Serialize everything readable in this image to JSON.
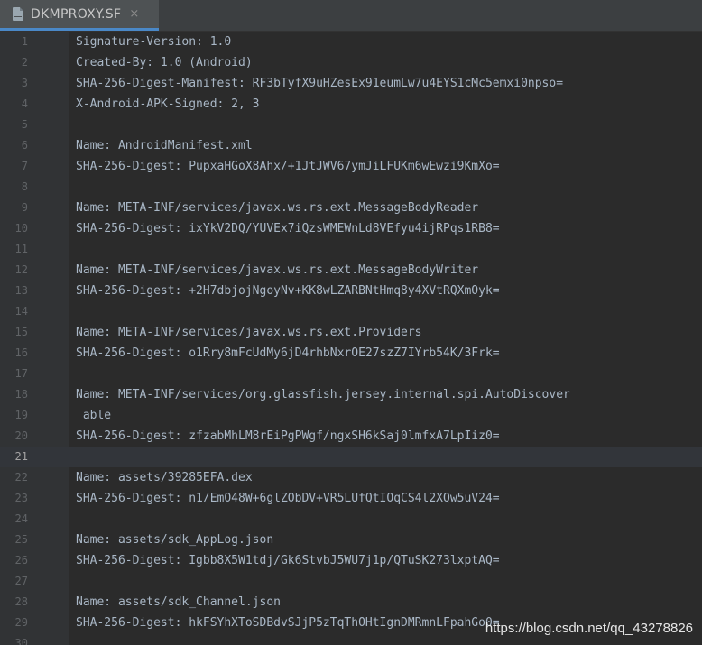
{
  "tab": {
    "title": "DKMPROXY.SF",
    "close_glyph": "×",
    "icon": "file-icon"
  },
  "lines": [
    "Signature-Version: 1.0",
    "Created-By: 1.0 (Android)",
    "SHA-256-Digest-Manifest: RF3bTyfX9uHZesEx91eumLw7u4EYS1cMc5emxi0npso=",
    "X-Android-APK-Signed: 2, 3",
    "",
    "Name: AndroidManifest.xml",
    "SHA-256-Digest: PupxaHGoX8Ahx/+1JtJWV67ymJiLFUKm6wEwzi9KmXo=",
    "",
    "Name: META-INF/services/javax.ws.rs.ext.MessageBodyReader",
    "SHA-256-Digest: ixYkV2DQ/YUVEx7iQzsWMEWnLd8VEfyu4ijRPqs1RB8=",
    "",
    "Name: META-INF/services/javax.ws.rs.ext.MessageBodyWriter",
    "SHA-256-Digest: +2H7dbjojNgoyNv+KK8wLZARBNtHmq8y4XVtRQXmOyk=",
    "",
    "Name: META-INF/services/javax.ws.rs.ext.Providers",
    "SHA-256-Digest: o1Rry8mFcUdMy6jD4rhbNxrOE27szZ7IYrb54K/3Frk=",
    "",
    "Name: META-INF/services/org.glassfish.jersey.internal.spi.AutoDiscover",
    " able",
    "SHA-256-Digest: zfzabMhLM8rEiPgPWgf/ngxSH6kSaj0lmfxA7LpIiz0=",
    "",
    "Name: assets/39285EFA.dex",
    "SHA-256-Digest: n1/EmO48W+6glZObDV+VR5LUfQtIOqCS4l2XQw5uV24=",
    "",
    "Name: assets/sdk_AppLog.json",
    "SHA-256-Digest: Igbb8X5W1tdj/Gk6StvbJ5WU7j1p/QTuSK273lxptAQ=",
    "",
    "Name: assets/sdk_Channel.json",
    "SHA-256-Digest: hkFSYhXToSDBdvSJjP5zTqThOHtIgnDMRmnLFpahGo0=",
    ""
  ],
  "caret_line": 21,
  "watermark": "https://blog.csdn.net/qq_43278826",
  "colors": {
    "background": "#2b2b2b",
    "gutter": "#313335",
    "text": "#a9b7c6",
    "tab_accent": "#4a88c7"
  }
}
